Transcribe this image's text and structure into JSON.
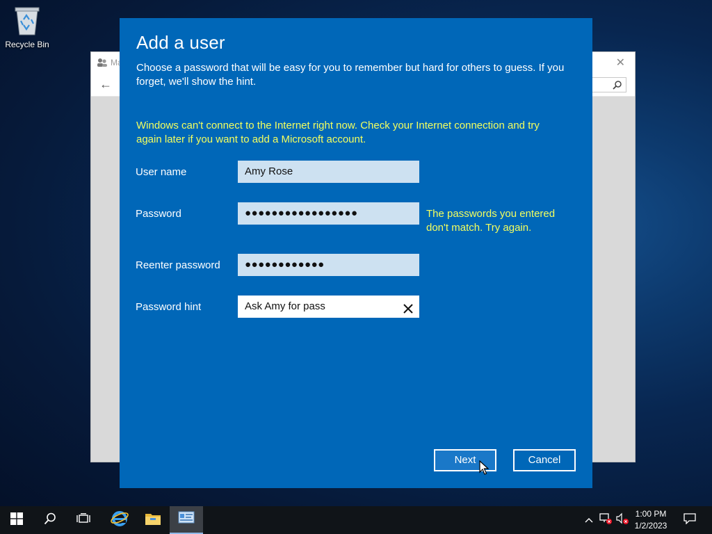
{
  "desktop": {
    "recycle_bin_label": "Recycle Bin"
  },
  "background_window": {
    "title_fragment": "Ma"
  },
  "dialog": {
    "title": "Add a user",
    "subtitle": "Choose a password that will be easy for you to remember but hard for others to guess. If you forget, we'll show the hint.",
    "warning": "Windows can't connect to the Internet right now. Check your Internet connection and try again later if you want to add a Microsoft account.",
    "fields": {
      "username": {
        "label": "User name",
        "value": "Amy Rose"
      },
      "password": {
        "label": "Password",
        "value": "●●●●●●●●●●●●●●●●●"
      },
      "reenter": {
        "label": "Reenter password",
        "value": "●●●●●●●●●●●●"
      },
      "hint": {
        "label": "Password hint",
        "value": "Ask Amy for pass"
      }
    },
    "mismatch_error": "The passwords you entered don't match. Try again.",
    "buttons": {
      "next": "Next",
      "cancel": "Cancel"
    }
  },
  "taskbar": {
    "time": "1:00 PM",
    "date": "1/2/2023"
  },
  "colors": {
    "dialog_bg": "#0067b8",
    "warning_text": "#f4ff5e",
    "field_bg": "#cde1f1"
  }
}
